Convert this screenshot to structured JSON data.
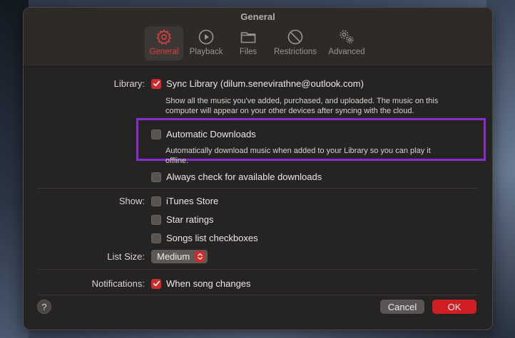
{
  "window": {
    "title": "General"
  },
  "tabs": [
    {
      "label": "General",
      "icon": "gear-icon",
      "active": true
    },
    {
      "label": "Playback",
      "icon": "play-circle-icon",
      "active": false
    },
    {
      "label": "Files",
      "icon": "folder-icon",
      "active": false
    },
    {
      "label": "Restrictions",
      "icon": "prohibited-icon",
      "active": false
    },
    {
      "label": "Advanced",
      "icon": "gears-icon",
      "active": false
    }
  ],
  "library": {
    "label": "Library:",
    "sync": {
      "text": "Sync Library (dilum.senevirathne@outlook.com)",
      "checked": true
    },
    "sync_desc": "Show all the music you've added, purchased, and uploaded. The music on this computer will appear on your other devices after syncing with the cloud.",
    "auto": {
      "text": "Automatic Downloads",
      "checked": false
    },
    "auto_desc": "Automatically download music when added to your Library so you can play it offline.",
    "always": {
      "text": "Always check for available downloads",
      "checked": false
    }
  },
  "show": {
    "label": "Show:",
    "items": [
      {
        "text": "iTunes Store",
        "checked": false
      },
      {
        "text": "Star ratings",
        "checked": false
      },
      {
        "text": "Songs list checkboxes",
        "checked": false
      }
    ]
  },
  "list_size": {
    "label": "List Size:",
    "value": "Medium"
  },
  "notifications": {
    "label": "Notifications:",
    "song_changes": {
      "text": "When song changes",
      "checked": true
    }
  },
  "footer": {
    "help": "?",
    "cancel": "Cancel",
    "ok": "OK"
  },
  "colors": {
    "accent": "#d12a2c",
    "highlight": "#8a2bd0",
    "window_bg": "#262422"
  }
}
